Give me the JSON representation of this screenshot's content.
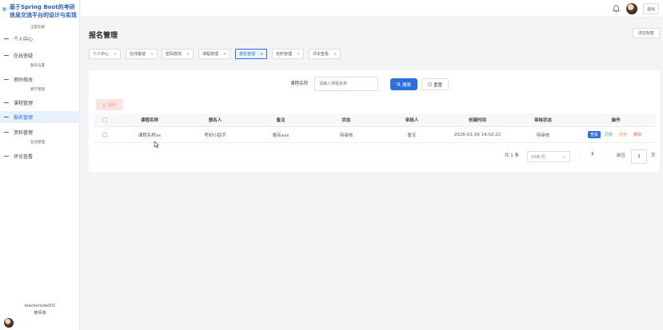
{
  "app": {
    "title": "基于Spring Boot的考研信息交流平台的设计与实现",
    "title_sub": "全部功能"
  },
  "sidebar": {
    "items": [
      {
        "label": "个人中心",
        "sub": ""
      },
      {
        "label": "在线答疑",
        "sub": "题号设置"
      },
      {
        "label": "密码修改",
        "sub": "教学管理"
      },
      {
        "label": "课程管理",
        "sub": ""
      },
      {
        "label": "报名管理",
        "sub": ""
      },
      {
        "label": "资料管理",
        "sub": "互动管理"
      },
      {
        "label": "评论查看",
        "sub": ""
      }
    ],
    "active_index": 4,
    "user": {
      "name": "teacherside001",
      "role": "教师端"
    }
  },
  "header": {
    "logout_label": "退出"
  },
  "page": {
    "title": "报名管理",
    "clear_tabs_label": "清空标签"
  },
  "tabs": [
    {
      "label": "个人中心"
    },
    {
      "label": "在线答疑"
    },
    {
      "label": "密码修改"
    },
    {
      "label": "课程管理"
    },
    {
      "label": "报名管理"
    },
    {
      "label": "资料管理"
    },
    {
      "label": "评论查看"
    }
  ],
  "tab_close": "×",
  "search": {
    "label": "课程名称",
    "placeholder": "请输入课程名称",
    "search_label": "搜索",
    "reset_label": "重置"
  },
  "toolbar": {
    "delete_label": "删除"
  },
  "table": {
    "headers": [
      "课程名称",
      "报名人",
      "备注",
      "状态",
      "审核人",
      "创建时间",
      "审核状态",
      "操作"
    ],
    "rows": [
      {
        "course": "课程名称xx",
        "applicant": "考研小助手",
        "note": "报名xxx",
        "status": "待审核",
        "reviewer": "暂无",
        "created": "2026-01-29 14:02:22",
        "review_status": "待审核",
        "actions": [
          "查看",
          "同意",
          "拒绝",
          "删除"
        ]
      }
    ]
  },
  "pagination": {
    "total": "共 1 条",
    "page_size": "10条/页",
    "prev": "‹",
    "current": "1",
    "next": "›",
    "goto_label": "前往",
    "goto_value": "1",
    "page_unit": "页"
  },
  "colors": {
    "primary": "#2d6fe0",
    "success": "#43b86b",
    "warning": "#e8a33a",
    "danger": "#e45a5a"
  }
}
